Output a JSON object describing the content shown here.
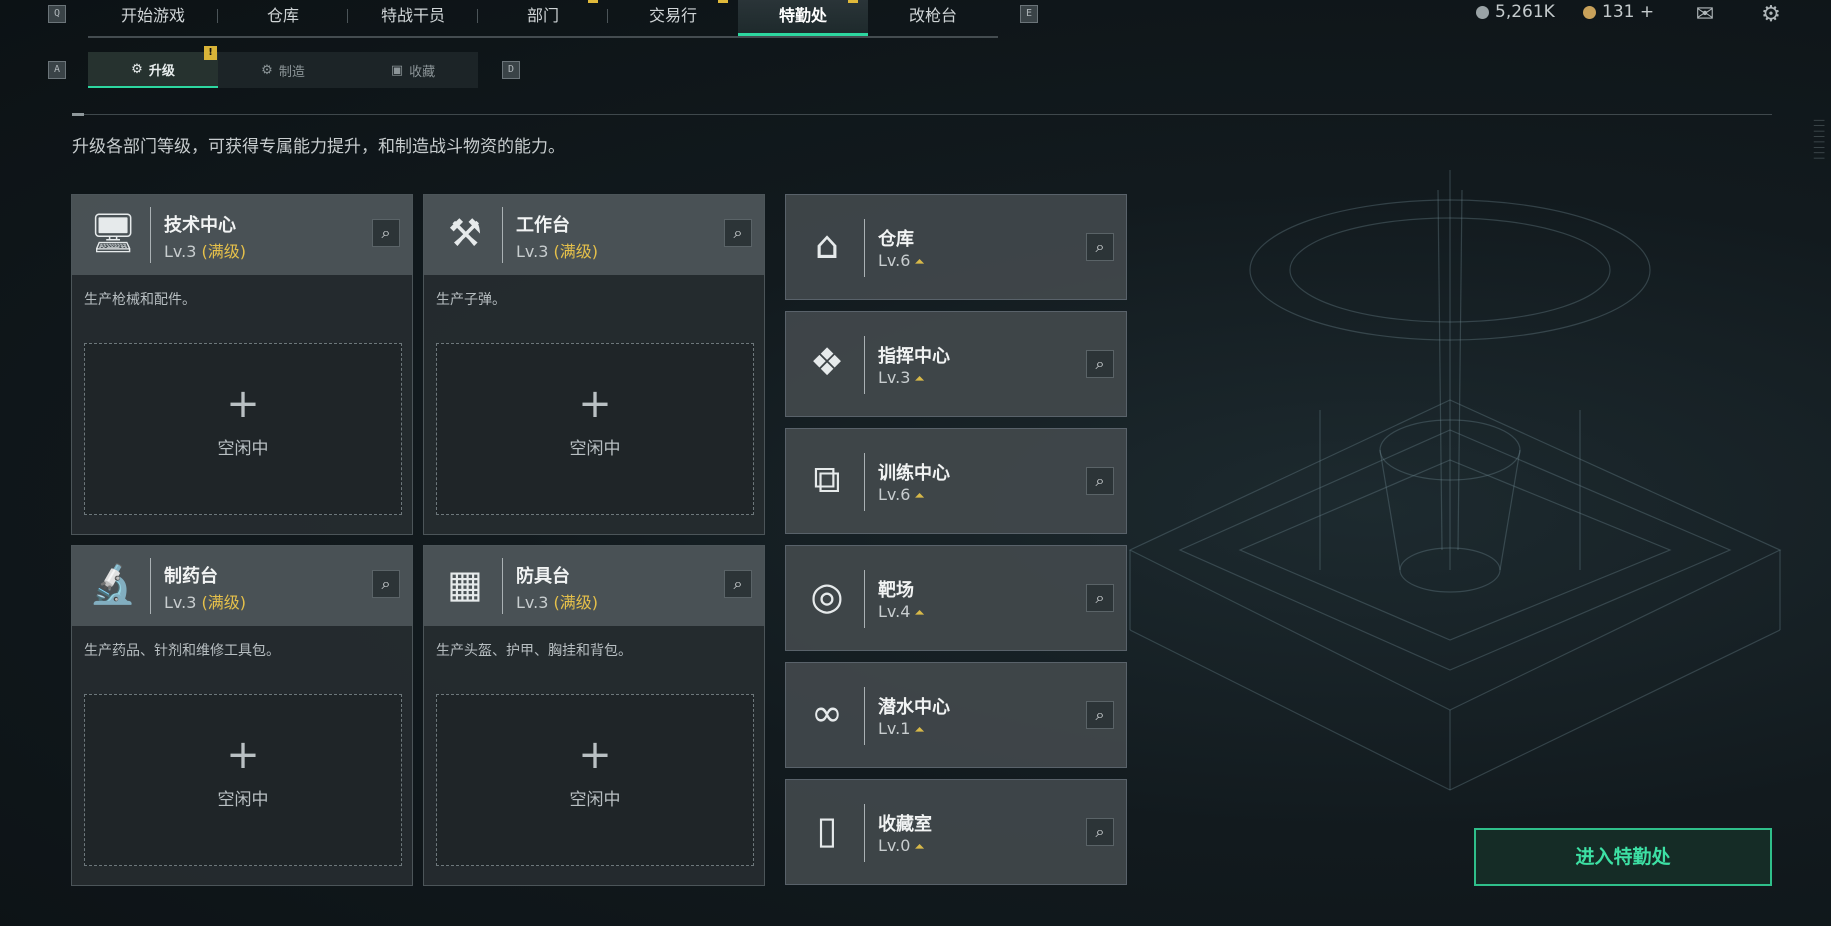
{
  "topbar": {
    "left_key": "Q",
    "right_key": "E",
    "tabs": [
      {
        "label": "开始游戏"
      },
      {
        "label": "仓库"
      },
      {
        "label": "特战干员"
      },
      {
        "label": "部门"
      },
      {
        "label": "交易行"
      },
      {
        "label": "特勤处"
      },
      {
        "label": "改枪台"
      }
    ],
    "active_tab": "特勤处",
    "currency_a": "5,261K",
    "currency_b": "131 +"
  },
  "subtabs": {
    "left_key": "A",
    "right_key": "D",
    "items": [
      {
        "label": "升级"
      },
      {
        "label": "制造"
      },
      {
        "label": "收藏"
      }
    ],
    "badge": "!"
  },
  "description": "升级各部门等级，可获得专属能力提升，和制造战斗物资的能力。",
  "workshops": [
    {
      "title": "技术中心",
      "level": "Lv.3",
      "max": "(满级)",
      "text": "生产枪械和配件。",
      "slot_plus": "+",
      "slot_status": "空闲中"
    },
    {
      "title": "工作台",
      "level": "Lv.3",
      "max": "(满级)",
      "text": "生产子弹。",
      "slot_plus": "+",
      "slot_status": "空闲中"
    },
    {
      "title": "制药台",
      "level": "Lv.3",
      "max": "(满级)",
      "text": "生产药品、针剂和维修工具包。",
      "slot_plus": "+",
      "slot_status": "空闲中"
    },
    {
      "title": "防具台",
      "level": "Lv.3",
      "max": "(满级)",
      "text": "生产头盔、护甲、胸挂和背包。",
      "slot_plus": "+",
      "slot_status": "空闲中"
    }
  ],
  "departments": [
    {
      "title": "仓库",
      "level": "Lv.6"
    },
    {
      "title": "指挥中心",
      "level": "Lv.3"
    },
    {
      "title": "训练中心",
      "level": "Lv.6"
    },
    {
      "title": "靶场",
      "level": "Lv.4"
    },
    {
      "title": "潜水中心",
      "level": "Lv.1"
    },
    {
      "title": "收藏室",
      "level": "Lv.0"
    }
  ],
  "enter_button": "进入特勤处",
  "colors": {
    "accent": "#2dd7a0",
    "max_level": "#e5c04a",
    "badge": "#d9b438"
  }
}
